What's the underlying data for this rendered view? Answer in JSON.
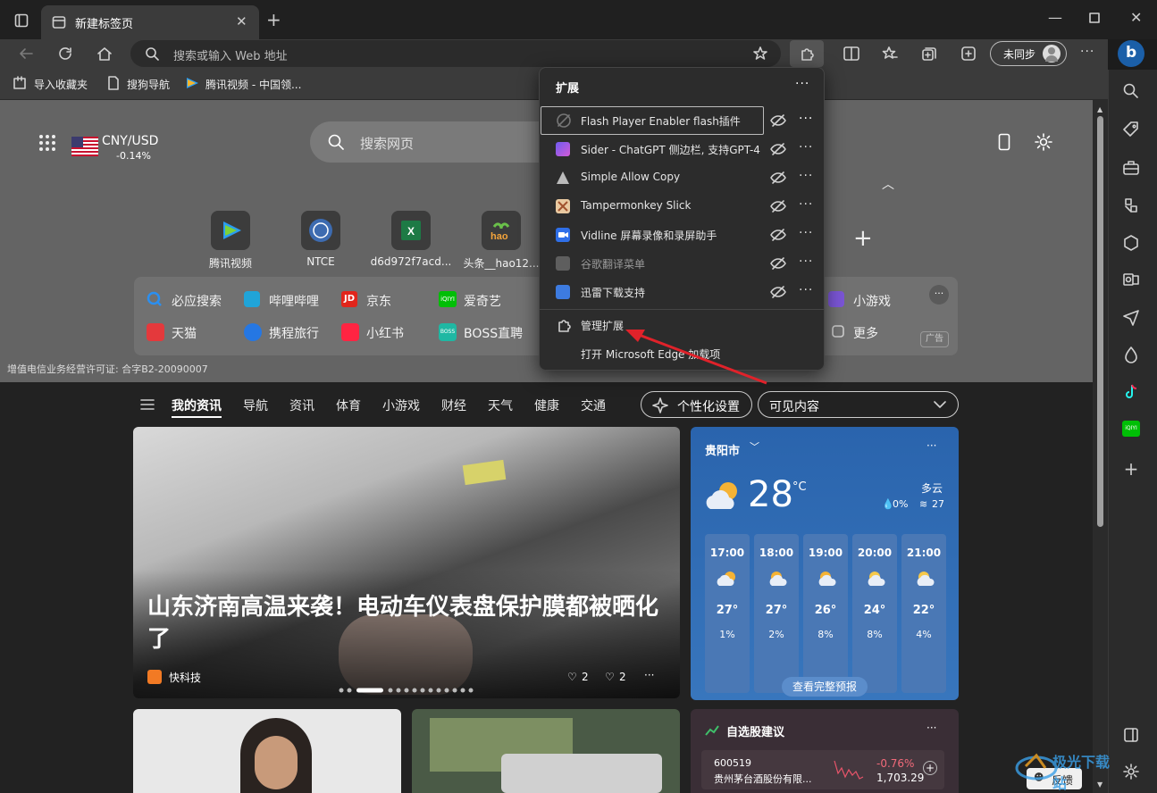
{
  "window": {
    "tab_title": "新建标签页",
    "sync_label": "未同步"
  },
  "address": {
    "placeholder": "搜索或输入 Web 地址"
  },
  "favorites": {
    "items": [
      {
        "label": "导入收藏夹"
      },
      {
        "label": "搜狗导航"
      },
      {
        "label": "腾讯视频 - 中国领..."
      }
    ]
  },
  "newtab": {
    "currency": {
      "pair": "CNY/USD",
      "change": "-0.14%"
    },
    "search_placeholder": "搜索网页",
    "quick": [
      {
        "label": "腾讯视频"
      },
      {
        "label": "NTCE"
      },
      {
        "label": "d6d972f7acd..."
      },
      {
        "label": "头条__hao12..."
      }
    ],
    "links_row1": [
      {
        "label": "必应搜索"
      },
      {
        "label": "哔哩哔哩"
      },
      {
        "label": "京东"
      },
      {
        "label": "爱奇艺"
      },
      {
        "label": "小游戏"
      }
    ],
    "links_row2": [
      {
        "label": "天猫"
      },
      {
        "label": "携程旅行"
      },
      {
        "label": "小红书"
      },
      {
        "label": "BOSS直聘"
      },
      {
        "label": "更多"
      }
    ],
    "ad_label": "广告",
    "license": "增值电信业务经营许可证: 合字B2-20090007"
  },
  "feed_nav": {
    "items": [
      "我的资讯",
      "导航",
      "资讯",
      "体育",
      "小游戏",
      "财经",
      "天气",
      "健康",
      "交通"
    ],
    "personalize": "个性化设置",
    "visible": "可见内容"
  },
  "hero": {
    "headline": "山东济南高温来袭！电动车仪表盘保护膜都被晒化了",
    "source": "快科技",
    "likes": "2",
    "dislikes": "2"
  },
  "weather": {
    "city": "贵阳市",
    "temp": "28",
    "unit": "°C",
    "condition": "多云",
    "precip": "0%",
    "wind": "27",
    "forecast_button": "查看完整预报",
    "hours": [
      {
        "time": "17:00",
        "temp": "27°",
        "precip": "1%"
      },
      {
        "time": "18:00",
        "temp": "27°",
        "precip": "2%"
      },
      {
        "time": "19:00",
        "temp": "26°",
        "precip": "8%"
      },
      {
        "time": "20:00",
        "temp": "24°",
        "precip": "8%"
      },
      {
        "time": "21:00",
        "temp": "22°",
        "precip": "4%"
      }
    ]
  },
  "stocks": {
    "title": "自选股建议",
    "code": "600519",
    "name": "贵州茅台酒股份有限...",
    "change": "-0.76%",
    "price": "1,703.29"
  },
  "extensions_menu": {
    "title": "扩展",
    "items": [
      {
        "label": "Flash Player Enabler flash插件",
        "color": "#444"
      },
      {
        "label": "Sider - ChatGPT 侧边栏, 支持GPT-4",
        "color": "#8a5cf0"
      },
      {
        "label": "Simple Allow Copy",
        "color": "#777"
      },
      {
        "label": "Tampermonkey Slick",
        "color": "#c8874a"
      },
      {
        "label": "Vidline 屏幕录像和录屏助手",
        "color": "#2f6fe8"
      },
      {
        "label": "谷歌翻译菜单",
        "color": "#666"
      },
      {
        "label": "迅雷下载支持",
        "color": "#3d7be0"
      }
    ],
    "manage": "管理扩展",
    "addons": "打开 Microsoft Edge 加载项"
  },
  "feedback": "反馈",
  "watermark": "极光下载站"
}
